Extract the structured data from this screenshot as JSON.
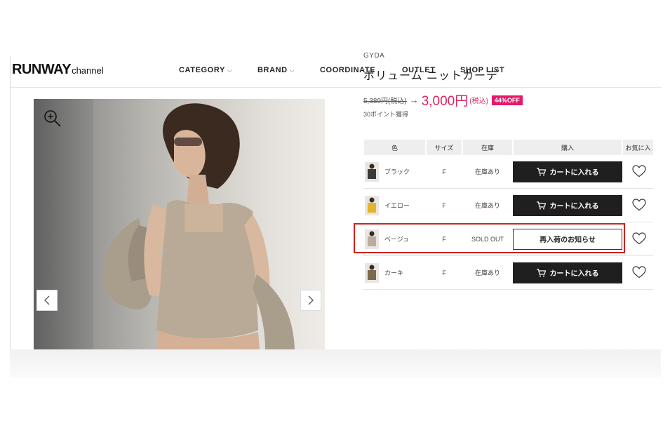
{
  "header": {
    "logo_main": "RUNWAY",
    "logo_sub": "channel",
    "nav": [
      {
        "label": "CATEGORY",
        "has_dropdown": true
      },
      {
        "label": "BRAND",
        "has_dropdown": true
      },
      {
        "label": "COORDINATE",
        "has_dropdown": false
      },
      {
        "label": "OUTLET",
        "has_dropdown": false
      },
      {
        "label": "SHOP LIST",
        "has_dropdown": false
      }
    ]
  },
  "product": {
    "brand": "GYDA",
    "title": "ボリューム ニットカーデ",
    "old_price": "5,389円(税込)",
    "arrow": "→",
    "new_price": "3,000円",
    "tax_note": "(税込)",
    "discount": "44%OFF",
    "points": "30ポイント獲得"
  },
  "gallery": {
    "zoom_icon": "zoom-in-icon",
    "prev_icon": "chevron-left-icon",
    "next_icon": "chevron-right-icon"
  },
  "sku_table": {
    "headers": [
      "色",
      "サイズ",
      "在庫",
      "購入",
      "お気に入"
    ],
    "rows": [
      {
        "color": "ブラック",
        "size": "F",
        "stock": "在庫あり",
        "action": "カートに入れる",
        "sold_out": false,
        "swatch": "#3a3a3a"
      },
      {
        "color": "イエロー",
        "size": "F",
        "stock": "在庫あり",
        "action": "カートに入れる",
        "sold_out": false,
        "swatch": "#e2b62a"
      },
      {
        "color": "ベージュ",
        "size": "F",
        "stock": "SOLD OUT",
        "action": "再入荷のお知らせ",
        "sold_out": true,
        "swatch": "#b9ad9d"
      },
      {
        "color": "カーキ",
        "size": "F",
        "stock": "在庫あり",
        "action": "カートに入れる",
        "sold_out": false,
        "swatch": "#7d6a4a"
      }
    ]
  },
  "colors": {
    "accent_pink": "#e0245e",
    "badge_pink": "#e6196b",
    "button_dark": "#1f1f1f",
    "highlight_red": "#d11f1f"
  }
}
